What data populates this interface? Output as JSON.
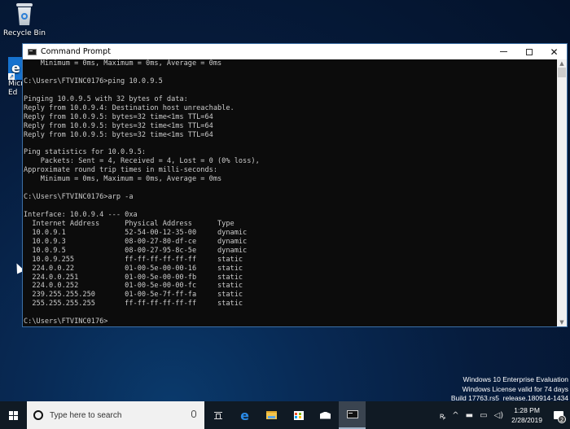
{
  "desktop": {
    "icons": [
      {
        "label": "Recycle Bin",
        "icon": "recycle-bin-icon"
      },
      {
        "label": "Micr Ed",
        "label_line1": "Micr",
        "label_line2": "Ed",
        "icon": "microsoft-edge-icon"
      }
    ],
    "watermark": {
      "line1": "Windows 10 Enterprise Evaluation",
      "line2": "Windows License valid for 74 days",
      "line3": "Build 17763.rs5_release.180914-1434"
    }
  },
  "window": {
    "title": "Command Prompt",
    "icon": "cmd-icon",
    "controls": {
      "minimize": "minimize-icon",
      "maximize": "maximize-icon",
      "close": "close-icon"
    },
    "console_lines": [
      "    Minimum = 0ms, Maximum = 0ms, Average = 0ms",
      "",
      "C:\\Users\\FTVINC0176>ping 10.0.9.5",
      "",
      "Pinging 10.0.9.5 with 32 bytes of data:",
      "Reply from 10.0.9.4: Destination host unreachable.",
      "Reply from 10.0.9.5: bytes=32 time<1ms TTL=64",
      "Reply from 10.0.9.5: bytes=32 time<1ms TTL=64",
      "Reply from 10.0.9.5: bytes=32 time<1ms TTL=64",
      "",
      "Ping statistics for 10.0.9.5:",
      "    Packets: Sent = 4, Received = 4, Lost = 0 (0% loss),",
      "Approximate round trip times in milli-seconds:",
      "    Minimum = 0ms, Maximum = 0ms, Average = 0ms",
      "",
      "C:\\Users\\FTVINC0176>arp -a",
      "",
      "Interface: 10.0.9.4 --- 0xa",
      "  Internet Address      Physical Address      Type",
      "  10.0.9.1              52-54-00-12-35-00     dynamic",
      "  10.0.9.3              08-00-27-80-df-ce     dynamic",
      "  10.0.9.5              08-00-27-95-8c-5e     dynamic",
      "  10.0.9.255            ff-ff-ff-ff-ff-ff     static",
      "  224.0.0.22            01-00-5e-00-00-16     static",
      "  224.0.0.251           01-00-5e-00-00-fb     static",
      "  224.0.0.252           01-00-5e-00-00-fc     static",
      "  239.255.255.250       01-00-5e-7f-ff-fa     static",
      "  255.255.255.255       ff-ff-ff-ff-ff-ff     static",
      "",
      "C:\\Users\\FTVINC0176>"
    ],
    "scrollbar": {
      "up": "▲",
      "down": "▼"
    }
  },
  "taskbar": {
    "start": "windows-start-icon",
    "search_placeholder": "Type here to search",
    "pinned": [
      {
        "name": "task-view",
        "icon": "task-view-icon"
      },
      {
        "name": "edge",
        "icon": "edge-icon",
        "glyph": "e"
      },
      {
        "name": "file-explorer",
        "icon": "folder-icon"
      },
      {
        "name": "store",
        "icon": "store-icon"
      },
      {
        "name": "mail",
        "icon": "mail-icon"
      },
      {
        "name": "command-prompt",
        "icon": "cmd-icon",
        "active": true
      }
    ],
    "tray": {
      "people": "ᴿ",
      "chevron": "^",
      "icons": [
        "battery-icon",
        "network-icon",
        "volume-icon"
      ],
      "time": "1:28 PM",
      "date": "2/28/2019",
      "notification_count": "2"
    }
  }
}
